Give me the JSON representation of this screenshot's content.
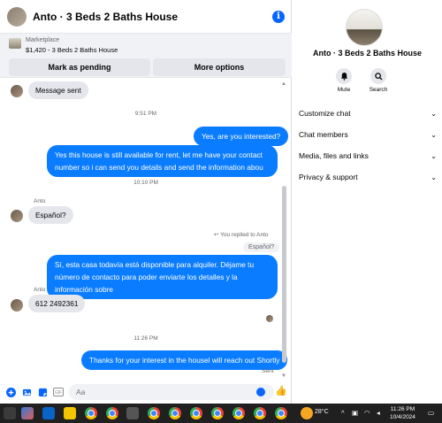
{
  "header": {
    "title": "Anto · 3 Beds 2 Baths House"
  },
  "marketplace": {
    "label": "Marketplace",
    "listing": "$1,420 - 3 Beds 2 Baths House",
    "pending_button": "Mark as pending",
    "more_button": "More options"
  },
  "messages": {
    "msg_sent": "Message sent",
    "time1": "9:51 PM",
    "out1": "Yes, are you interested?",
    "out2": "Yes this house is still available for rent, let me have your contact number so i can send you details and send the information abou",
    "time2": "10:10 PM",
    "sender1": "Anto",
    "in1": "Español?",
    "replied_label": "You replied to Anto",
    "reply_quote": "Español?",
    "out3": "Sí, esta casa todavía está disponible para alquiler. Déjame tu número de contacto para poder enviarte los detalles y la información sobre",
    "sender2": "Anto",
    "in2": "612 2492361",
    "time3": "11:26 PM",
    "out4": "Thanks for your interest in the housel will reach out Shortly",
    "status": "Sent"
  },
  "composer": {
    "placeholder": "Aa"
  },
  "side": {
    "name": "Anto · 3 Beds 2 Baths House",
    "mute_label": "Mute",
    "search_label": "Search",
    "rows": [
      "Customize chat",
      "Chat members",
      "Media, files and links",
      "Privacy & support"
    ]
  },
  "taskbar": {
    "temp": "28°C",
    "time": "11:26 PM",
    "date": "10/4/2024"
  },
  "colors": {
    "accent": "#0866ff",
    "bubble_out": "#0a7cff",
    "bubble_in": "#e4e6eb"
  }
}
